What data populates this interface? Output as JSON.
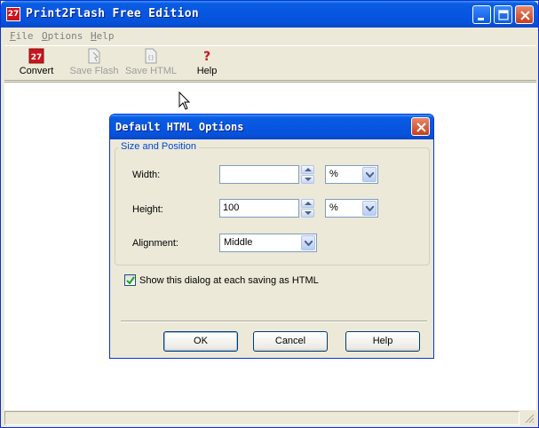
{
  "window": {
    "title": "Print2Flash Free Edition",
    "app_icon_text": "27"
  },
  "menu": {
    "items": [
      {
        "label": "File",
        "mnemonic": "F",
        "rest": "ile"
      },
      {
        "label": "Options",
        "mnemonic": "O",
        "rest": "ptions"
      },
      {
        "label": "Help",
        "mnemonic": "H",
        "rest": "elp"
      }
    ]
  },
  "toolbar": {
    "buttons": [
      {
        "label": "Convert",
        "icon": "print2flash-convert-icon",
        "enabled": true
      },
      {
        "label": "Save Flash",
        "icon": "save-flash-icon",
        "enabled": false
      },
      {
        "label": "Save HTML",
        "icon": "save-html-icon",
        "enabled": false
      },
      {
        "label": "Help",
        "icon": "question-mark-icon",
        "enabled": true
      }
    ]
  },
  "dialog": {
    "title": "Default HTML Options",
    "group_label": "Size and Position",
    "width": {
      "label": "Width:",
      "value": "",
      "unit": "%"
    },
    "height": {
      "label": "Height:",
      "value": "100",
      "unit": "%"
    },
    "alignment": {
      "label": "Alignment:",
      "value": "Middle"
    },
    "show_dialog_checkbox": {
      "label": "Show this dialog at each saving as HTML",
      "checked": true
    },
    "buttons": {
      "ok": "OK",
      "cancel": "Cancel",
      "help": "Help"
    }
  },
  "colors": {
    "titlebar": "#0a5ddf",
    "close_button": "#c83f1a",
    "window_face": "#ece9d8",
    "group_label": "#0046d5"
  }
}
